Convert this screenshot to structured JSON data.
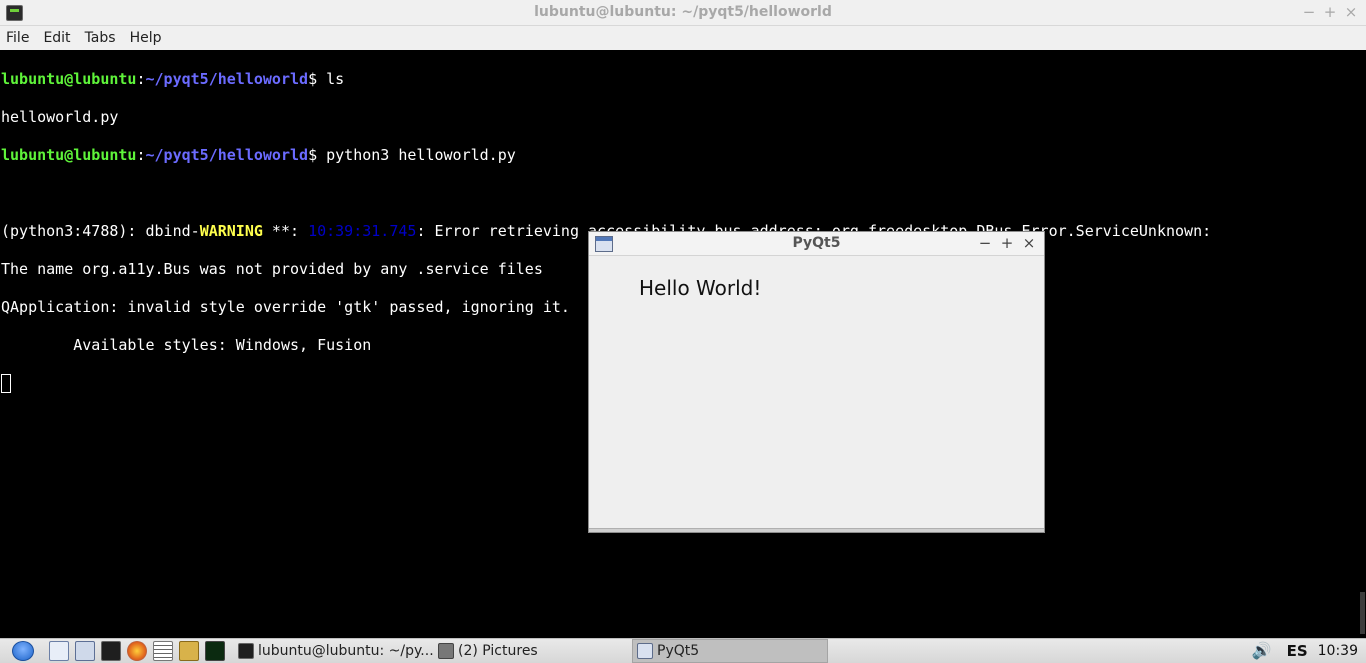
{
  "terminal_window": {
    "title": "lubuntu@lubuntu: ~/pyqt5/helloworld",
    "controls": {
      "minimize": "−",
      "maximize": "+",
      "close": "×"
    },
    "menu": [
      "File",
      "Edit",
      "Tabs",
      "Help"
    ]
  },
  "terminal": {
    "prompt_user": "lubuntu@lubuntu",
    "prompt_sep": ":",
    "prompt_path": "~/pyqt5/helloworld",
    "prompt_end": "$ ",
    "cmd1": "ls",
    "out1": "helloworld.py",
    "cmd2": "python3 helloworld.py",
    "warn_prefix": "(python3:4788): dbind-",
    "warn_word": "WARNING",
    "warn_mid": " **: ",
    "warn_time": "10:39:31.745",
    "warn_rest": ": Error retrieving accessibility bus address: org.freedesktop.DBus.Error.ServiceUnknown:",
    "line_name": "The name org.a11y.Bus was not provided by any .service files",
    "line_qapp": "QApplication: invalid style override 'gtk' passed, ignoring it.",
    "line_styles": "        Available styles: Windows, Fusion"
  },
  "pyqt_window": {
    "title": "PyQt5",
    "label": "Hello World!",
    "controls": {
      "minimize": "−",
      "maximize": "+",
      "close": "×"
    }
  },
  "taskbar": {
    "launchers": [
      "menu-icon",
      "desktop-icon",
      "file-manager-icon",
      "terminal-icon",
      "firefox-icon",
      "text-editor-icon",
      "image-viewer-icon",
      "system-monitor-icon"
    ],
    "tasks": [
      {
        "label": "lubuntu@lubuntu: ~/py...",
        "active": false
      },
      {
        "label": "(2) Pictures",
        "active": false
      },
      {
        "label": "PyQt5",
        "active": true
      }
    ],
    "language": "ES",
    "clock": "10:39"
  },
  "colors": {
    "prompt_user": "#5ff43a",
    "prompt_path": "#6b6bff",
    "warning": "#ffff4d",
    "timestamp": "#0000c8"
  }
}
